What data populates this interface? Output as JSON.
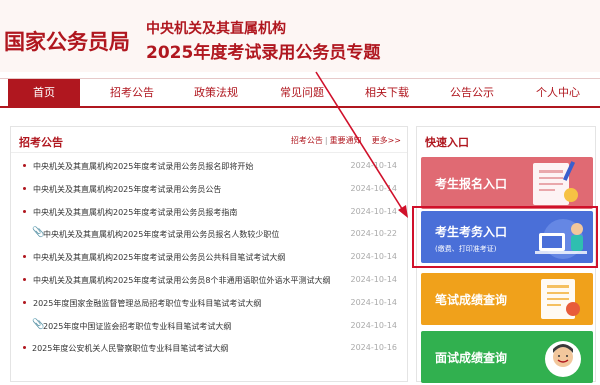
{
  "header": {
    "site_name": "国家公务员局",
    "subtitle1": "中央机关及其直属机构",
    "subtitle2": "2025年度考试录用公务员专题"
  },
  "nav": {
    "items": [
      {
        "label": "首页",
        "active": true
      },
      {
        "label": "招考公告",
        "active": false
      },
      {
        "label": "政策法规",
        "active": false
      },
      {
        "label": "常见问题",
        "active": false
      },
      {
        "label": "相关下载",
        "active": false
      },
      {
        "label": "公告公示",
        "active": false
      },
      {
        "label": "个人中心",
        "active": false
      }
    ]
  },
  "announcements": {
    "title": "招考公告",
    "link1": "招考公告",
    "separator": "|",
    "link2": "重要通知",
    "more": "更多>>",
    "items": [
      {
        "title": "中央机关及其直属机构2025年度考试录用公务员报名即将开始",
        "date": "2024-10-14",
        "icon": "bullet"
      },
      {
        "title": "中央机关及其直属机构2025年度考试录用公务员公告",
        "date": "2024-10-14",
        "icon": "bullet"
      },
      {
        "title": "中央机关及其直属机构2025年度考试录用公务员报考指南",
        "date": "2024-10-14",
        "icon": "bullet"
      },
      {
        "title": "中央机关及其直属机构2025年度考试录用公务员报名人数较少职位",
        "date": "2024-10-22",
        "icon": "clip"
      },
      {
        "title": "中央机关及其直属机构2025年度考试录用公务员公共科目笔试考试大纲",
        "date": "2024-10-14",
        "icon": "bullet"
      },
      {
        "title": "中央机关及其直属机构2025年度考试录用公务员8个非通用语职位外语水平测试大纲",
        "date": "2024-10-14",
        "icon": "bullet"
      },
      {
        "title": "2025年度国家金融监督管理总局招考职位专业科目笔试考试大纲",
        "date": "2024-10-14",
        "icon": "bullet"
      },
      {
        "title": "2025年度中国证监会招考职位专业科目笔试考试大纲",
        "date": "2024-10-14",
        "icon": "clip"
      },
      {
        "title": "2025年度公安机关人民警察职位专业科目笔试考试大纲",
        "date": "2024-10-16",
        "icon": "none"
      }
    ]
  },
  "quick": {
    "title": "快速入口",
    "cards": [
      {
        "label": "考生报名入口",
        "sub": ""
      },
      {
        "label": "考生考务入口",
        "sub": "(缴费、打印准考证)"
      },
      {
        "label": "笔试成绩查询",
        "sub": ""
      },
      {
        "label": "面试成绩查询",
        "sub": ""
      }
    ]
  },
  "colors": {
    "brand": "#b0171f",
    "pink": "#e06a73",
    "blue": "#4a6fd8",
    "orange": "#f0a11b",
    "green": "#31b04f",
    "highlight": "#d0102a"
  },
  "icons": [
    "bullet-icon",
    "paperclip-icon",
    "form-document-icon",
    "person-at-computer-icon",
    "exam-paper-icon",
    "smiling-person-icon",
    "red-arrow-annotation"
  ]
}
